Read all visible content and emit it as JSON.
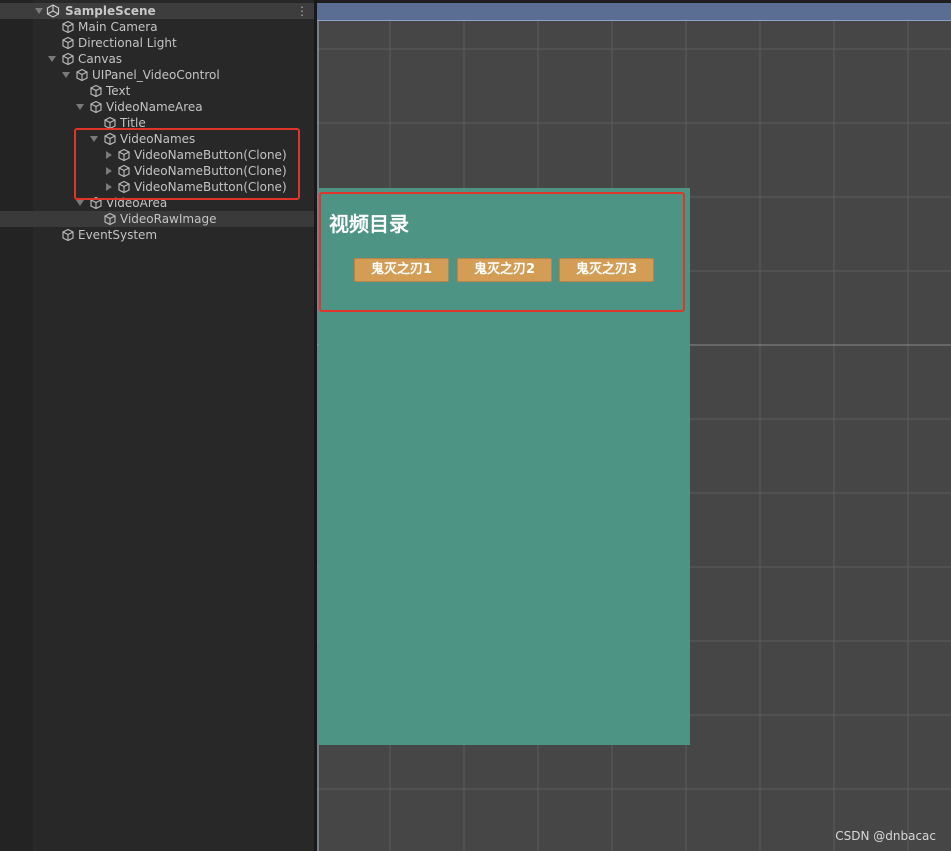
{
  "hierarchy": {
    "scene_name": "SampleScene",
    "menu_glyph": "⋮",
    "items": [
      {
        "label": "Main Camera"
      },
      {
        "label": "Directional Light"
      },
      {
        "label": "Canvas"
      },
      {
        "label": "UIPanel_VideoControl"
      },
      {
        "label": "Text"
      },
      {
        "label": "VideoNameArea"
      },
      {
        "label": "Title"
      },
      {
        "label": "VideoNames"
      },
      {
        "label": "VideoNameButton(Clone)"
      },
      {
        "label": "VideoNameButton(Clone)"
      },
      {
        "label": "VideoNameButton(Clone)"
      },
      {
        "label": "VideoArea"
      },
      {
        "label": "VideoRawImage"
      },
      {
        "label": "EventSystem"
      }
    ]
  },
  "scene": {
    "panel_title": "视频目录",
    "buttons": [
      {
        "label": "鬼灭之刃1"
      },
      {
        "label": "鬼灭之刃2"
      },
      {
        "label": "鬼灭之刃3"
      }
    ]
  },
  "watermark": "CSDN @dnbacac",
  "colors": {
    "panel_bg": "#4e9484",
    "button_bg": "#d49d56",
    "highlight": "#e0352b",
    "scene_bg": "#464646",
    "hierarchy_bg": "#282828"
  }
}
